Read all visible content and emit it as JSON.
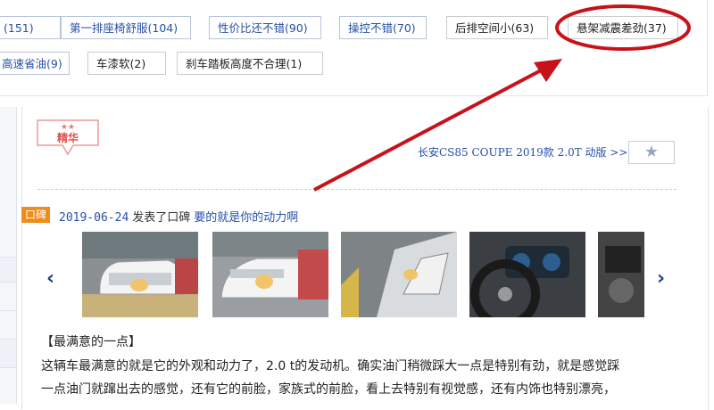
{
  "tags": {
    "row1": [
      {
        "label": "(151)",
        "style": "blue"
      },
      {
        "label": "第一排座椅舒服(104)",
        "style": "blue"
      },
      {
        "label": "性价比还不错(90)",
        "style": "blue"
      },
      {
        "label": "操控不错(70)",
        "style": "blue"
      },
      {
        "label": "后排空间小(63)",
        "style": "black"
      },
      {
        "label": "悬架减震差劲(37)",
        "style": "black"
      }
    ],
    "row2": [
      {
        "label": "高速省油(9)",
        "style": "blue"
      },
      {
        "label": "车漆软(2)",
        "style": "black"
      },
      {
        "label": "刹车踏板高度不合理(1)",
        "style": "black"
      }
    ]
  },
  "post": {
    "badge_stars": "★★",
    "badge_text": "精华",
    "model_link": "长安CS85 COUPE 2019款 2.0T 动版 >>",
    "favorite_icon": "star-icon",
    "favorite_glyph": "★",
    "type_badge": "口碑",
    "date": "2019-06-24",
    "action": "发表了口碑",
    "title": "要的就是你的动力啊",
    "prev_glyph": "‹",
    "next_glyph": "›",
    "section_title": "【最满意的一点】",
    "body_lines": [
      "这辆车最满意的就是它的外观和动力了，2.0 t的发动机。确实油门稍微踩大一点是特别有劲，就是感觉踩",
      "一点油门就蹿出去的感觉，还有它的前脸，家族式的前脸，看上去特别有视觉感，还有内饰也特别漂亮，"
    ]
  },
  "colors": {
    "annotation_red": "#c8121a",
    "link_blue": "#2650a8",
    "badge_orange": "#f08c1e"
  }
}
